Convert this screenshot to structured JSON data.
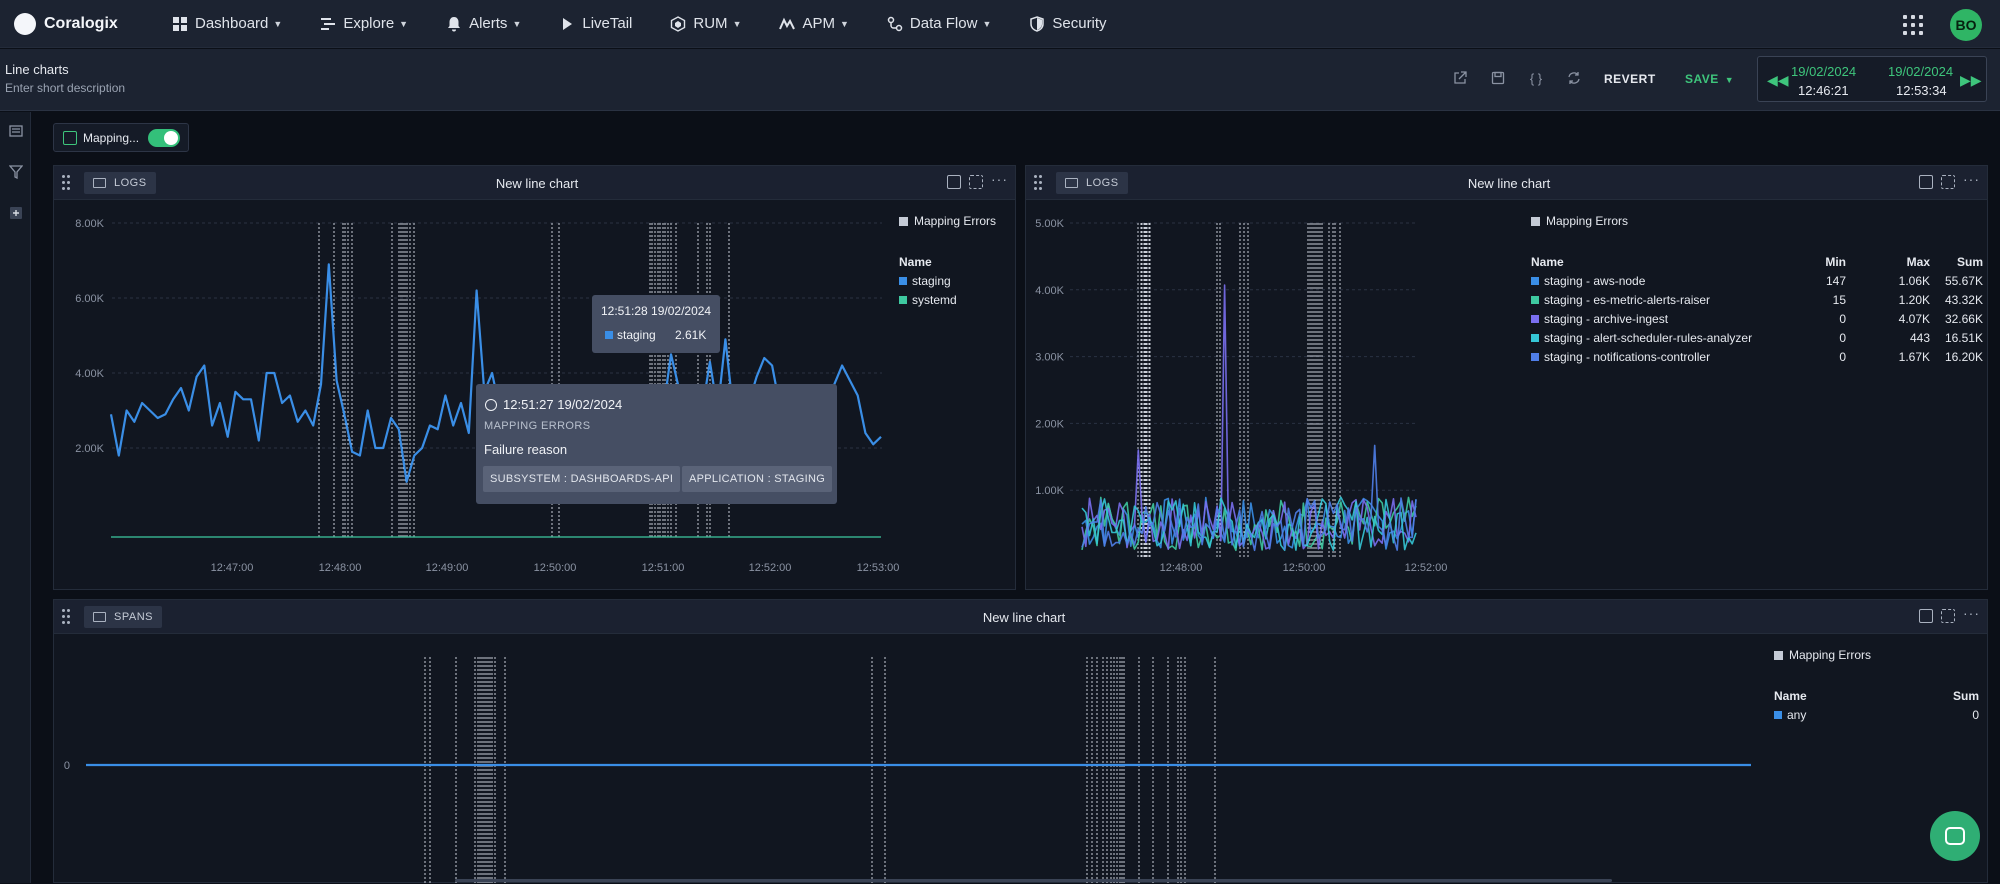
{
  "app": {
    "logo_text": "Coralogix",
    "user_initials": "BO"
  },
  "nav": [
    {
      "label": "Dashboard",
      "icon": "dashboard-icon",
      "caret": true
    },
    {
      "label": "Explore",
      "icon": "explore-icon",
      "caret": true
    },
    {
      "label": "Alerts",
      "icon": "bell-icon",
      "caret": true
    },
    {
      "label": "LiveTail",
      "icon": "play-icon",
      "caret": false
    },
    {
      "label": "RUM",
      "icon": "rum-icon",
      "caret": true
    },
    {
      "label": "APM",
      "icon": "apm-icon",
      "caret": true
    },
    {
      "label": "Data Flow",
      "icon": "dataflow-icon",
      "caret": true
    },
    {
      "label": "Security",
      "icon": "shield-icon",
      "caret": false
    }
  ],
  "dashboard": {
    "title": "Line charts",
    "description": "Enter short description"
  },
  "toolbar": {
    "revert": "REVERT",
    "save": "SAVE"
  },
  "timerange": {
    "from_date": "19/02/2024",
    "from_time": "12:46:21",
    "to_date": "19/02/2024",
    "to_time": "12:53:34"
  },
  "variable_chip": {
    "label": "Mapping..."
  },
  "colors": {
    "accent": "#3ec57c",
    "staging": "#3a8ee6",
    "systemd": "#3ec9a0"
  },
  "panels": [
    {
      "source": "LOGS",
      "title": "New line chart",
      "legend_title": "Mapping Errors",
      "legend_header": "Name",
      "legend": [
        {
          "name": "staging",
          "color": "#3a8ee6"
        },
        {
          "name": "systemd",
          "color": "#3ec9a0"
        }
      ]
    },
    {
      "source": "LOGS",
      "title": "New line chart",
      "legend_title": "Mapping Errors",
      "legend_header": {
        "name": "Name",
        "min": "Min",
        "max": "Max",
        "sum": "Sum"
      },
      "legend": [
        {
          "name": "staging - aws-node",
          "color": "#3a8ee6",
          "min": "147",
          "max": "1.06K",
          "sum": "55.67K"
        },
        {
          "name": "staging - es-metric-alerts-raiser",
          "color": "#3ec9a0",
          "min": "15",
          "max": "1.20K",
          "sum": "43.32K"
        },
        {
          "name": "staging - archive-ingest",
          "color": "#7a6ff0",
          "min": "0",
          "max": "4.07K",
          "sum": "32.66K"
        },
        {
          "name": "staging - alert-scheduler-rules-analyzer",
          "color": "#35c6d6",
          "min": "0",
          "max": "443",
          "sum": "16.51K"
        },
        {
          "name": "staging - notifications-controller",
          "color": "#4f7ee8",
          "min": "0",
          "max": "1.67K",
          "sum": "16.20K"
        }
      ]
    },
    {
      "source": "SPANS",
      "title": "New line chart",
      "legend_title": "Mapping Errors",
      "legend_header": {
        "name": "Name",
        "sum": "Sum"
      },
      "legend": [
        {
          "name": "any",
          "color": "#3a8ee6",
          "sum": "0"
        }
      ]
    }
  ],
  "tooltip_small": {
    "time": "12:51:28 19/02/2024",
    "series": "staging",
    "value": "2.61K"
  },
  "tooltip_big": {
    "time": "12:51:27 19/02/2024",
    "category": "MAPPING ERRORS",
    "reason": "Failure reason",
    "tags": [
      "SUBSYSTEM : DASHBOARDS-API",
      "APPLICATION : STAGING"
    ]
  },
  "chart_data": [
    {
      "type": "line",
      "ylim": [
        0,
        8000
      ],
      "y_ticks": [
        "8.00K",
        "6.00K",
        "4.00K",
        "2.00K"
      ],
      "x_ticks": [
        "12:47:00",
        "12:48:00",
        "12:49:00",
        "12:50:00",
        "12:51:00",
        "12:52:00",
        "12:53:00"
      ],
      "series": [
        {
          "name": "staging",
          "values": [
            2900,
            1800,
            3000,
            2700,
            3200,
            3000,
            2800,
            2900,
            3300,
            3600,
            3000,
            3900,
            4200,
            2600,
            3200,
            2300,
            3500,
            3300,
            3300,
            2200,
            4000,
            4000,
            3200,
            3400,
            2700,
            3000,
            2600,
            3700,
            6900,
            3800,
            2900,
            1900,
            1800,
            3000,
            2000,
            2000,
            2800,
            2500,
            1100,
            1800,
            2000,
            2600,
            2500,
            3400,
            2600,
            3200,
            2400,
            6200,
            3500,
            4000,
            3000,
            3100,
            3400,
            3100,
            2900,
            2700,
            3000,
            3100,
            2900,
            2400,
            2900,
            2000,
            3000,
            2700,
            1300,
            2700,
            2400,
            2900,
            3600,
            2400,
            2200,
            3000,
            4500,
            3600,
            3300,
            3600,
            3000,
            4300,
            3000,
            4900,
            3000,
            3600,
            3200,
            3900,
            4400,
            4200,
            3100,
            2700,
            3000,
            2000,
            3600,
            3500,
            2200,
            3700,
            4200,
            3800,
            3400,
            2400,
            2100,
            2300
          ]
        },
        {
          "name": "systemd",
          "values": [
            0,
            0,
            0,
            0,
            0,
            0,
            0,
            0,
            0,
            0,
            0,
            0,
            0,
            0,
            0,
            0,
            0,
            0,
            0,
            0
          ]
        }
      ]
    },
    {
      "type": "line",
      "ylim": [
        0,
        5000
      ],
      "y_ticks": [
        "5.00K",
        "4.00K",
        "3.00K",
        "2.00K",
        "1.00K"
      ],
      "x_ticks": [
        "12:48:00",
        "12:50:00",
        "12:52:00"
      ]
    },
    {
      "type": "line",
      "y_ticks": [
        "0"
      ],
      "series": [
        {
          "name": "any",
          "values": [
            0,
            0
          ]
        }
      ]
    }
  ]
}
